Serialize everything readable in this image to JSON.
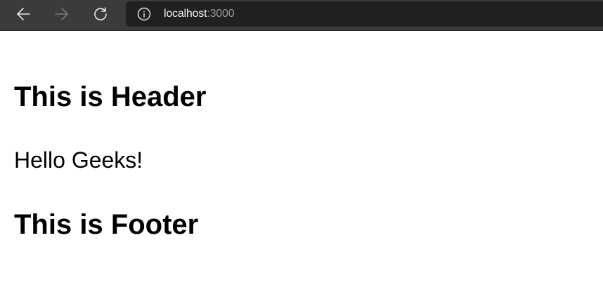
{
  "browser": {
    "url_host": "localhost",
    "url_port": ":3000"
  },
  "page": {
    "header": "This is Header",
    "body_text": "Hello Geeks!",
    "footer": "This is Footer"
  },
  "colors": {
    "toolbar_bg": "#3b3b3b",
    "address_bar_bg": "#202020",
    "page_bg": "#ffffff"
  },
  "icons": {
    "back": "arrow-left-icon",
    "forward": "arrow-right-icon",
    "refresh": "refresh-icon",
    "site_info": "info-icon"
  }
}
